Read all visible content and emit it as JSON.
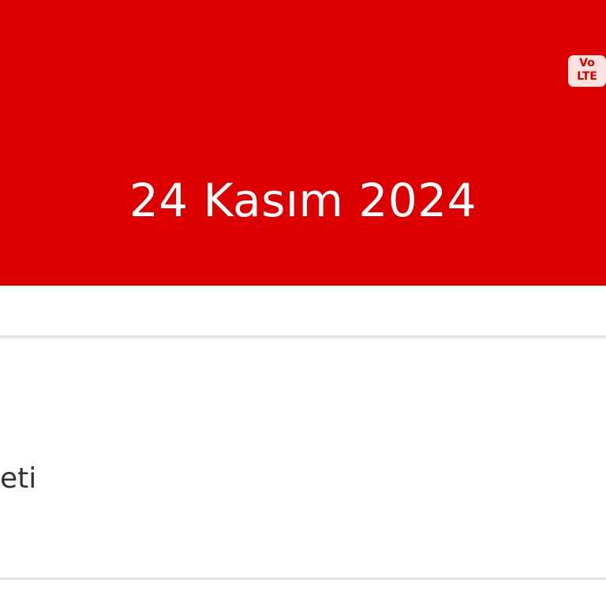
{
  "status_bar": {
    "volte_top": "Vo",
    "volte_bottom": "LTE",
    "badge_color": "#fbe3df",
    "brand_color": "#dc0000"
  },
  "header": {
    "date": "24 Kasım 2024"
  },
  "list": {
    "items": [
      {
        "label": "eti"
      }
    ]
  }
}
